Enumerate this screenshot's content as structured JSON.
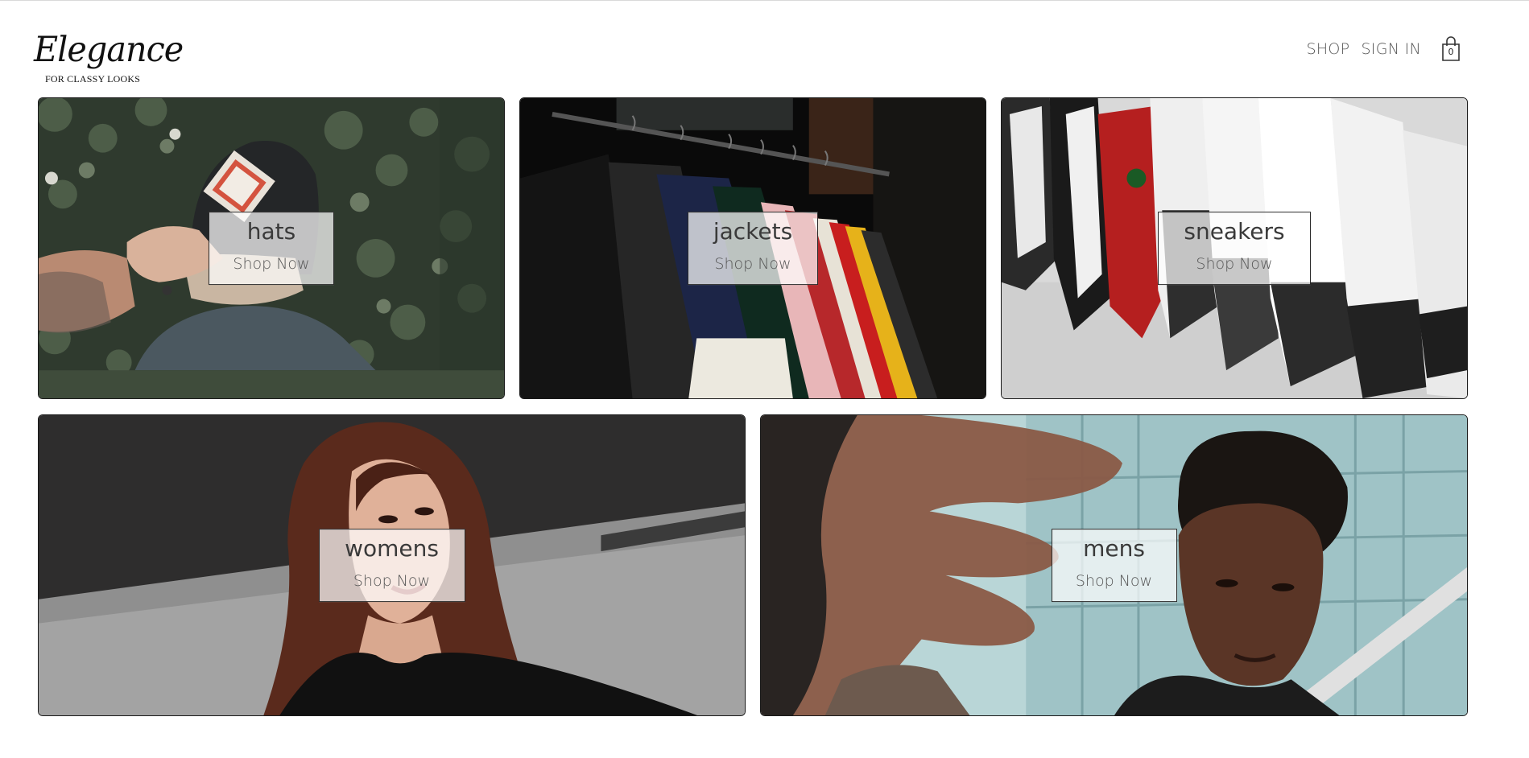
{
  "brand": {
    "name": "Elegance",
    "tagline": "FOR CLASSY LOOKS"
  },
  "nav": {
    "shop": "SHOP",
    "sign_in": "SIGN IN",
    "cart_icon": "shopping-bag-icon",
    "cart_count": "0"
  },
  "categories": [
    {
      "title": "hats",
      "cta": "Shop Now"
    },
    {
      "title": "jackets",
      "cta": "Shop Now"
    },
    {
      "title": "sneakers",
      "cta": "Shop Now"
    },
    {
      "title": "womens",
      "cta": "Shop Now"
    },
    {
      "title": "mens",
      "cta": "Shop Now"
    }
  ],
  "colors": {
    "text": "#555555",
    "border": "#1a1a1a",
    "background": "#ffffff"
  }
}
